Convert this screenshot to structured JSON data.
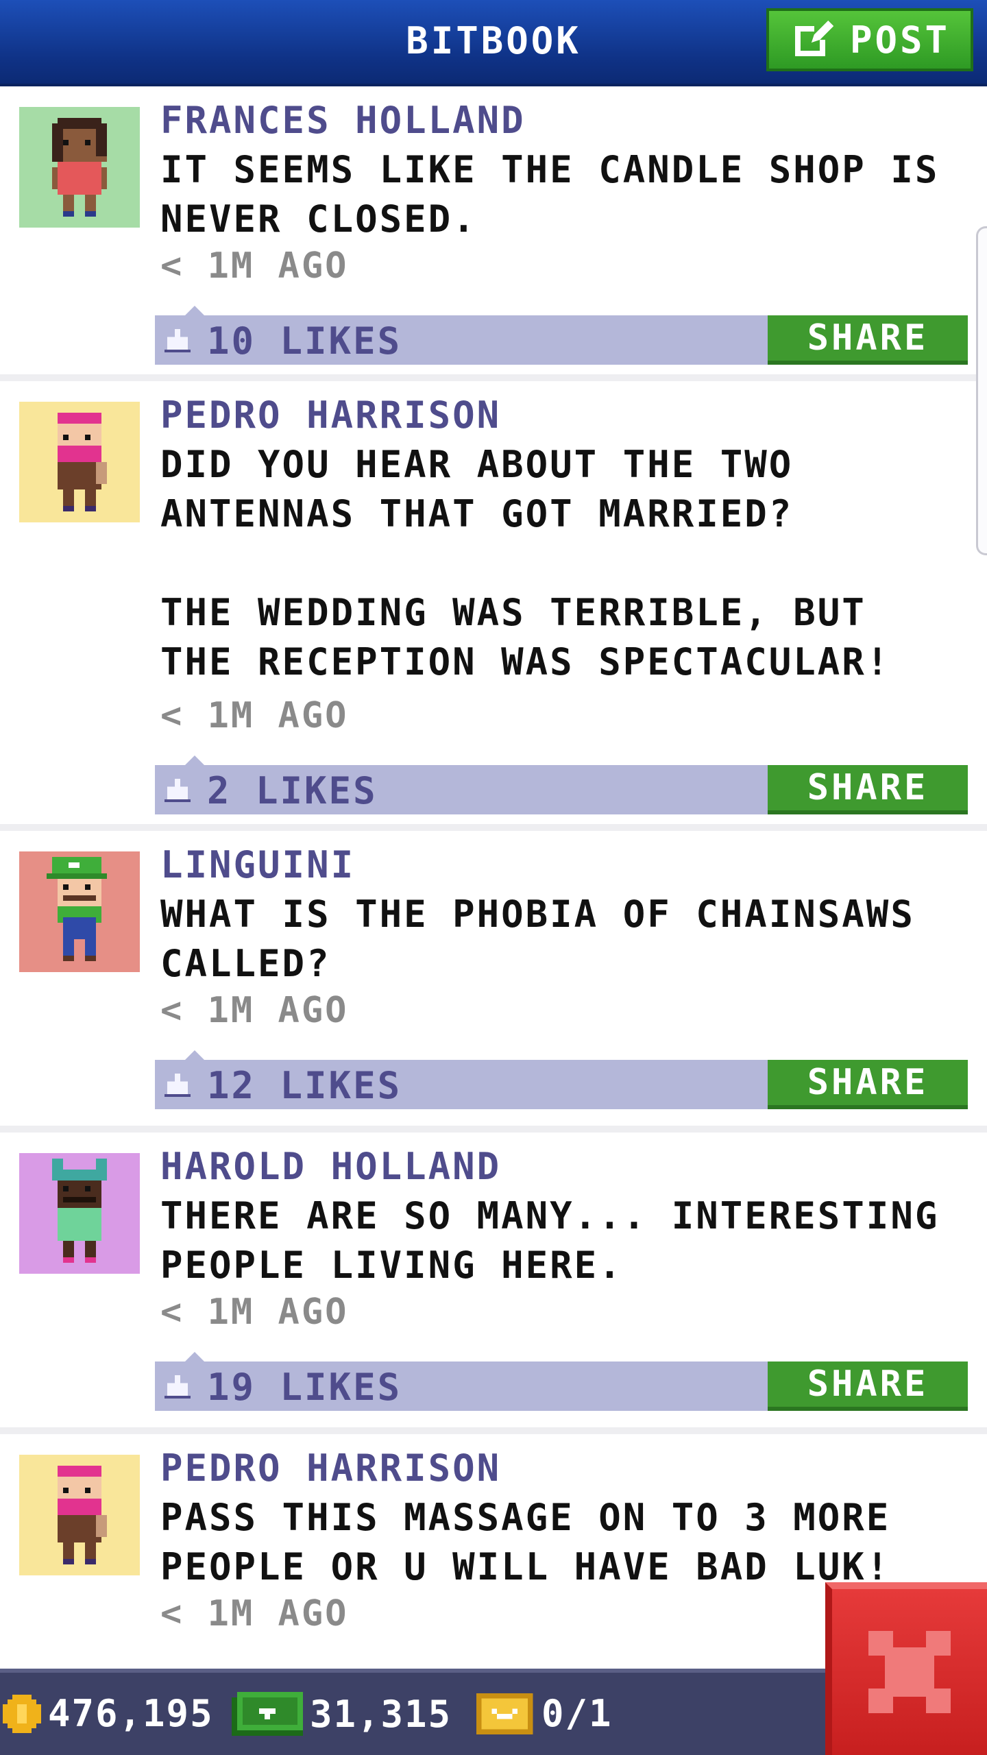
{
  "header": {
    "title": "BITBOOK",
    "post_label": "POST"
  },
  "posts": [
    {
      "author": "FRANCES HOLLAND",
      "text": "IT SEEMS LIKE THE CANDLE SHOP IS NEVER CLOSED.",
      "time": "< 1M AGO",
      "likes": "10 LIKES",
      "share": "SHARE",
      "avatar_bg": "#a6dca6"
    },
    {
      "author": "PEDRO HARRISON",
      "text": "DID YOU HEAR ABOUT THE TWO ANTENNAS THAT GOT MARRIED?\n\nTHE WEDDING WAS TERRIBLE, BUT THE RECEPTION WAS SPECTACULAR!",
      "time": "< 1M AGO",
      "likes": "2 LIKES",
      "share": "SHARE",
      "avatar_bg": "#f9e69a"
    },
    {
      "author": "LINGUINI",
      "text": "WHAT IS THE PHOBIA OF CHAINSAWS CALLED?",
      "time": "< 1M AGO",
      "likes": "12 LIKES",
      "share": "SHARE",
      "avatar_bg": "#e68f86"
    },
    {
      "author": "HAROLD HOLLAND",
      "text": "THERE ARE SO MANY... INTERESTING PEOPLE LIVING HERE.",
      "time": "< 1M AGO",
      "likes": "19 LIKES",
      "share": "SHARE",
      "avatar_bg": "#d99be6"
    },
    {
      "author": "PEDRO HARRISON",
      "text": "PASS THIS MASSAGE ON TO 3 MORE PEOPLE OR U WILL HAVE BAD LUK!",
      "time": "< 1M AGO",
      "likes": "",
      "share": "",
      "avatar_bg": "#f9e69a"
    }
  ],
  "bottom_bar": {
    "coins": "476,195",
    "bux": "31,315",
    "tickets": "0/1"
  },
  "colors": {
    "header": "#0f3286",
    "author": "#4f4c8c",
    "likes_bar": "#b4b7d9",
    "share": "#3f9a2f",
    "close": "#d42a2a"
  },
  "icons": {
    "post": "edit-icon",
    "like": "thumbs-up-icon",
    "coin": "coin-icon",
    "bux": "bux-icon",
    "ticket": "ticket-icon",
    "close": "close-icon"
  }
}
